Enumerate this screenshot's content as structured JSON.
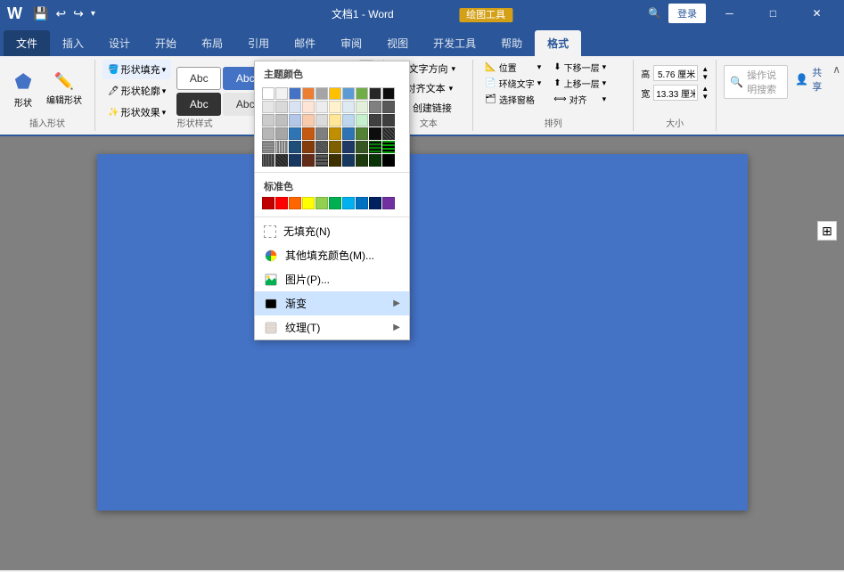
{
  "titleBar": {
    "title": "文档1 - Word",
    "drawingTools": "绘图工具",
    "loginBtn": "登录",
    "quickAccess": [
      "💾",
      "↩",
      "↪",
      "▾"
    ]
  },
  "tabs": [
    {
      "label": "文件",
      "active": false
    },
    {
      "label": "插入",
      "active": false
    },
    {
      "label": "设计",
      "active": false
    },
    {
      "label": "开始",
      "active": false
    },
    {
      "label": "布局",
      "active": false
    },
    {
      "label": "引用",
      "active": false
    },
    {
      "label": "邮件",
      "active": false
    },
    {
      "label": "审阅",
      "active": false
    },
    {
      "label": "视图",
      "active": false
    },
    {
      "label": "开发工具",
      "active": false
    },
    {
      "label": "帮助",
      "active": false
    },
    {
      "label": "格式",
      "active": true
    }
  ],
  "ribbonGroups": {
    "insertShape": {
      "label": "插入形状",
      "shapeSamples": [
        "Abc",
        "Abc",
        "Abc"
      ]
    },
    "shapeStyles": {
      "label": "形状样式"
    },
    "text": {
      "label": "文本",
      "items": [
        "文字方向",
        "对齐文本",
        "创建链接"
      ]
    },
    "arrange": {
      "label": "排列",
      "items": [
        "位置",
        "环绕文字",
        "选择窗格",
        "下移一层",
        "上移一层",
        "对齐"
      ]
    },
    "size": {
      "label": "大小",
      "height": "5.76 厘米",
      "width": "13.33 厘米"
    }
  },
  "fillMenu": {
    "title": "形状填充 ▾",
    "themeLabel": "主题颜色",
    "stdLabel": "标准色",
    "noFill": "无填充(N)",
    "moreColors": "其他填充颜色(M)...",
    "picture": "图片(P)...",
    "gradient": "渐变",
    "texture": "纹理(T)",
    "themeColors": [
      [
        "#ffffff",
        "#ffffff",
        "#ffffff",
        "#ffffff",
        "#f0f0f0",
        "#dcdcdc",
        "#808080",
        "#404040",
        "#202020",
        "#000000"
      ],
      [
        "#f2dcdb",
        "#fce4d6",
        "#fff2cc",
        "#ebf3d9",
        "#daeef3",
        "#dce6f1",
        "#e8d9f0",
        "#dce0e8",
        "#fde9d9",
        "#eeece1"
      ],
      [
        "#e6b8b7",
        "#f9c9b8",
        "#ffe699",
        "#d8e9b3",
        "#b7dde8",
        "#b8cce4",
        "#d1afd7",
        "#bbc3d0",
        "#fbd5b5",
        "#d8d0c4"
      ],
      [
        "#da9694",
        "#f5a570",
        "#ffcd28",
        "#c4d79b",
        "#92cddc",
        "#95b3d7",
        "#b36be8",
        "#95a5ba",
        "#f8aa60",
        "#c3b8a8"
      ],
      [
        "#c0504d",
        "#e36c09",
        "#f7bb00",
        "#9bbb59",
        "#31849b",
        "#4f81bd",
        "#8064a2",
        "#17375e",
        "#f79646",
        "#938953"
      ],
      [
        "#963634",
        "#974706",
        "#e06000",
        "#76923c",
        "#215868",
        "#24619f",
        "#5f4c99",
        "#0f2439",
        "#e26b0a",
        "#494429"
      ]
    ],
    "stdColors": [
      "#ff0000",
      "#ff6600",
      "#ffff00",
      "#92d050",
      "#00b050",
      "#00b0f0",
      "#0070c0",
      "#002060",
      "#7030a0",
      "#000000"
    ],
    "gradientArrow": "▶",
    "textureArrow": "▶"
  },
  "searchPlaceholder": "操作说明搜索",
  "shareBtn": "共享",
  "collapseBtn": "∧"
}
